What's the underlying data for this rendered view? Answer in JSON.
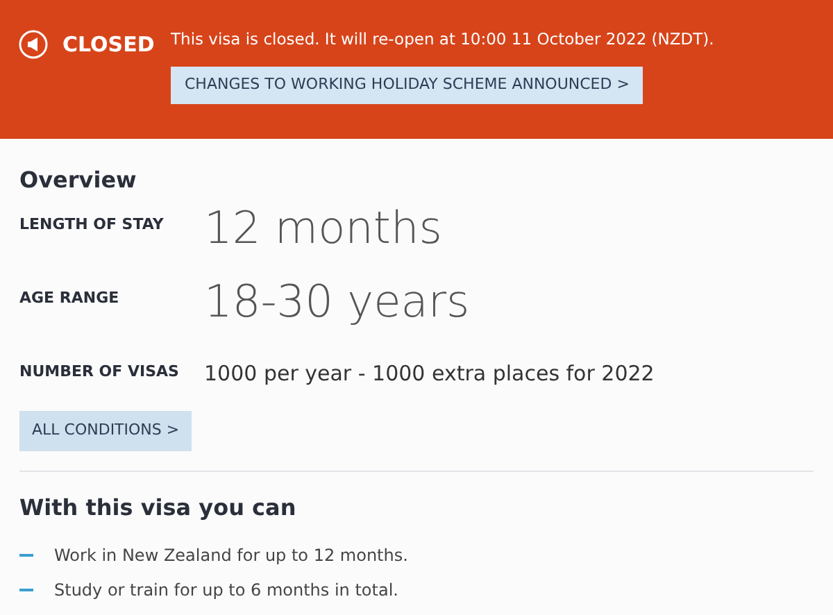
{
  "banner": {
    "status": "CLOSED",
    "message": "This visa is closed. It will re-open at 10:00 11 October 2022 (NZDT).",
    "link": "CHANGES TO WORKING HOLIDAY SCHEME ANNOUNCED >"
  },
  "overview": {
    "title": "Overview",
    "rows": [
      {
        "label": "LENGTH OF STAY",
        "value": "12 months",
        "kind": "large"
      },
      {
        "label": "AGE RANGE",
        "value": "18-30 years",
        "kind": "large"
      },
      {
        "label": "NUMBER OF VISAS",
        "value": "1000 per year - 1000 extra places for 2022",
        "kind": "normal"
      }
    ],
    "button": "ALL CONDITIONS >"
  },
  "benefits": {
    "title": "With this visa you can",
    "items": [
      "Work in New Zealand for up to 12 months.",
      "Study or train for up to 6 months in total."
    ]
  }
}
